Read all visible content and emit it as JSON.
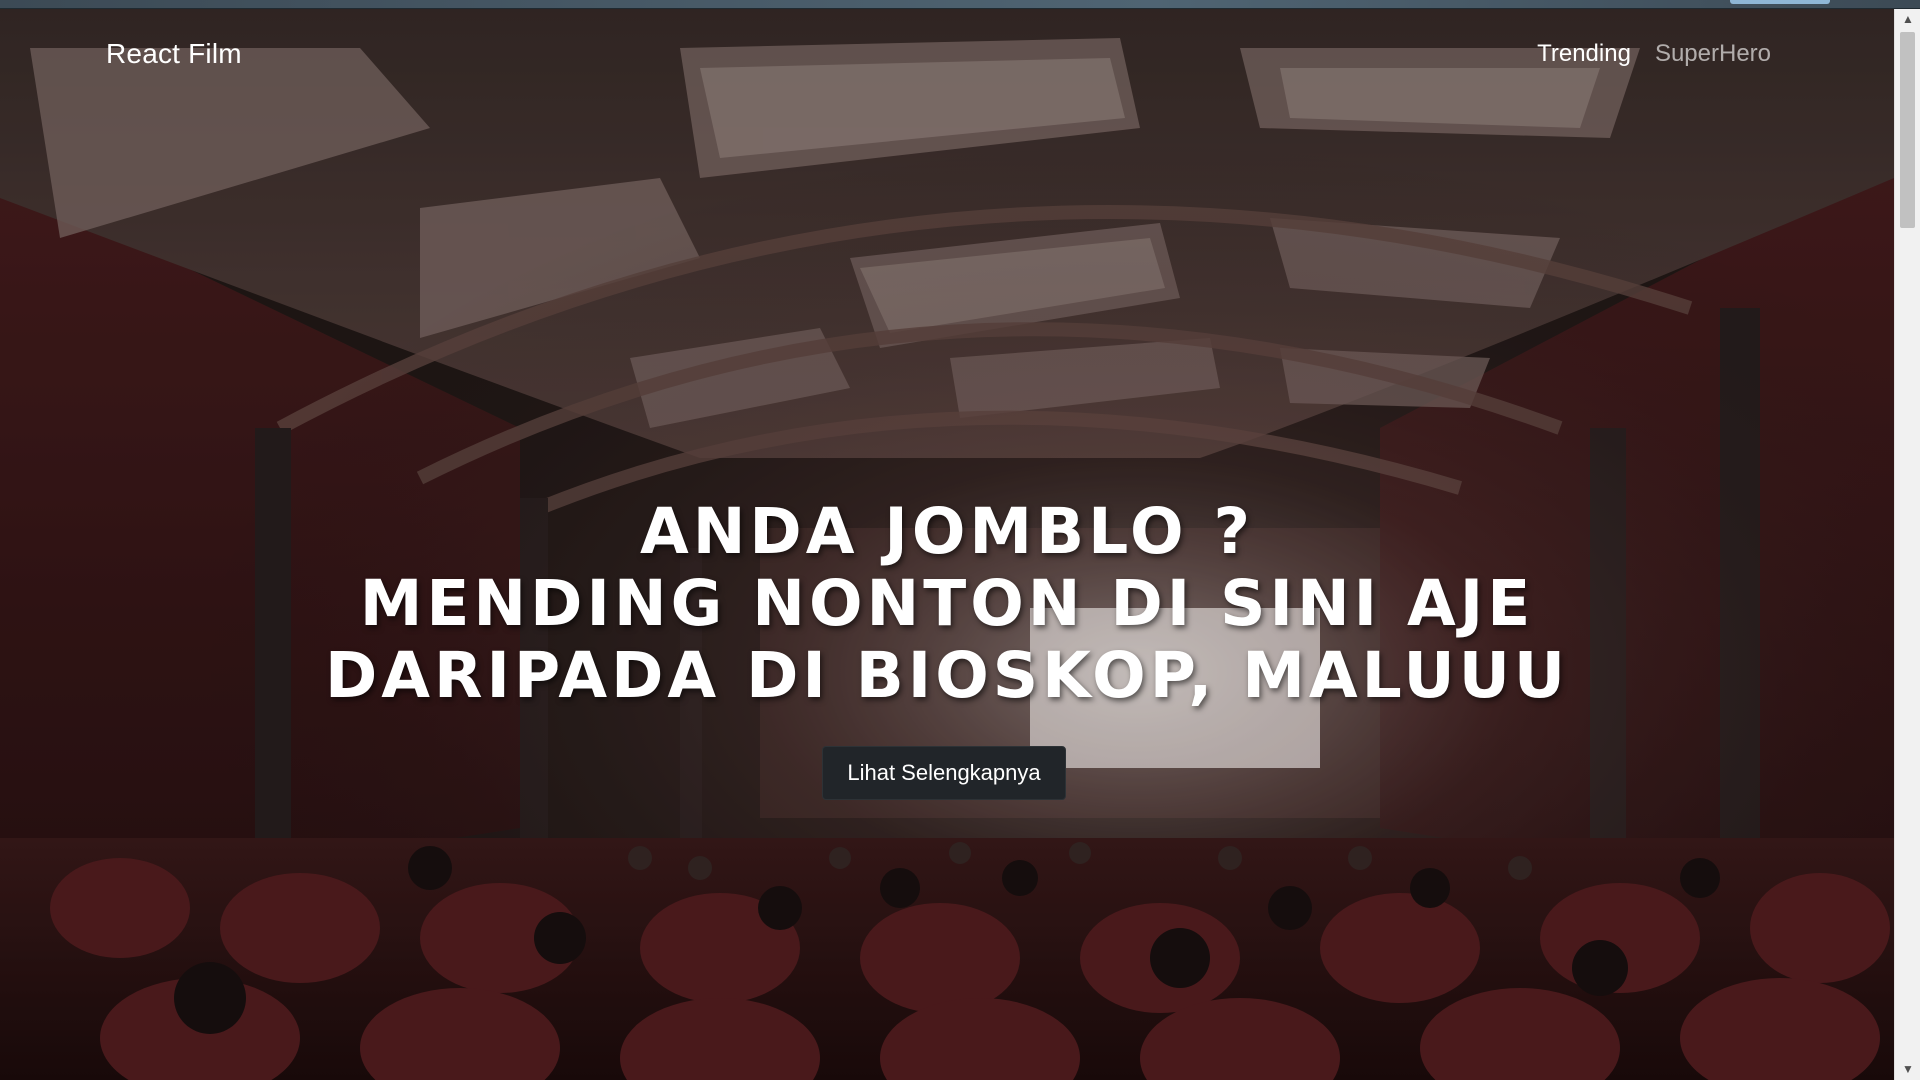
{
  "navbar": {
    "brand": "React Film",
    "links": [
      {
        "label": "Trending",
        "active": true
      },
      {
        "label": "SuperHero",
        "active": false
      }
    ]
  },
  "hero": {
    "headline_lines": [
      "ANDA JOMBLO ?",
      "MENDING NONTON DI SINI AJE",
      "DARIPADA DI BIOSKOP, MALUUU"
    ],
    "cta_label": "Lihat Selengkapnya",
    "background_image": "cinema-auditorium-photo"
  },
  "scrollbar": {
    "up_icon": "scroll-up-arrow-icon",
    "down_icon": "scroll-down-arrow-icon"
  },
  "colors": {
    "button_bg": "#212529",
    "text": "#ffffff",
    "nav_muted": "rgba(255,255,255,0.62)"
  }
}
